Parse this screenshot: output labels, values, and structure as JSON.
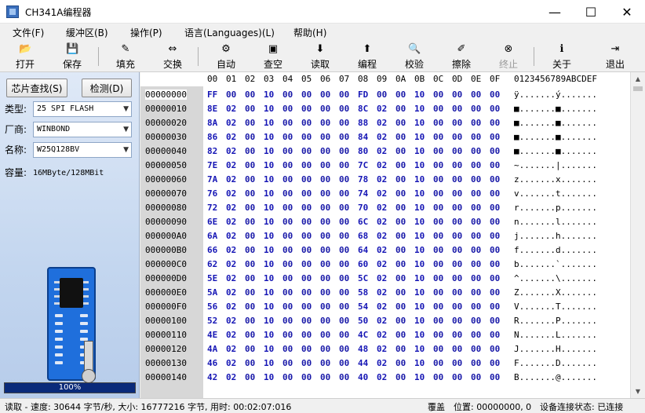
{
  "window": {
    "title": "CH341A编程器",
    "min_glyph": "—",
    "max_glyph": "☐",
    "close_glyph": "✕"
  },
  "menu": [
    "文件(F)",
    "缓冲区(B)",
    "操作(P)",
    "语言(Languages)(L)",
    "帮助(H)"
  ],
  "toolbar": [
    {
      "label": "打开",
      "icon": "open-folder-icon",
      "glyph": "📂",
      "enabled": true
    },
    {
      "label": "保存",
      "icon": "save-disk-icon",
      "glyph": "💾",
      "enabled": true
    },
    {
      "label": "填充",
      "icon": "fill-icon",
      "glyph": "✎",
      "enabled": true
    },
    {
      "label": "交换",
      "icon": "swap-arrows-icon",
      "glyph": "⇔",
      "enabled": true
    },
    {
      "label": "自动",
      "icon": "auto-icon",
      "glyph": "⚙",
      "enabled": true
    },
    {
      "label": "查空",
      "icon": "blank-check-icon",
      "glyph": "▣",
      "enabled": true
    },
    {
      "label": "读取",
      "icon": "read-icon",
      "glyph": "⬇",
      "enabled": true
    },
    {
      "label": "编程",
      "icon": "program-icon",
      "glyph": "⬆",
      "enabled": true
    },
    {
      "label": "校验",
      "icon": "verify-icon",
      "glyph": "🔍",
      "enabled": true
    },
    {
      "label": "擦除",
      "icon": "erase-icon",
      "glyph": "✐",
      "enabled": true
    },
    {
      "label": "终止",
      "icon": "stop-icon",
      "glyph": "⊗",
      "enabled": false
    },
    {
      "label": "关于",
      "icon": "about-info-icon",
      "glyph": "ℹ",
      "enabled": true
    },
    {
      "label": "退出",
      "icon": "exit-icon",
      "glyph": "⇥",
      "enabled": true
    }
  ],
  "left": {
    "find_chip": "芯片查找(S)",
    "detect": "检测(D)",
    "type_label": "类型:",
    "type_value": "25 SPI FLASH",
    "vendor_label": "厂商:",
    "vendor_value": "WINBOND",
    "name_label": "名称:",
    "name_value": "W25Q128BV",
    "capacity_label": "容量:",
    "capacity_value": "16MByte/128MBit",
    "progress_text": "100%",
    "progress": 1.0
  },
  "hex": {
    "header_cols": [
      "00",
      "01",
      "02",
      "03",
      "04",
      "05",
      "06",
      "07",
      "08",
      "09",
      "0A",
      "0B",
      "0C",
      "0D",
      "0E",
      "0F"
    ],
    "ascii_header": "0123456789ABCDEF",
    "rows": [
      {
        "addr": "00000000",
        "bytes": [
          "FF",
          "00",
          "00",
          "10",
          "00",
          "00",
          "00",
          "00",
          "FD",
          "00",
          "00",
          "10",
          "00",
          "00",
          "00",
          "00"
        ],
        "ascii": "ÿ.......ý......."
      },
      {
        "addr": "00000010",
        "bytes": [
          "8E",
          "02",
          "00",
          "10",
          "00",
          "00",
          "00",
          "00",
          "8C",
          "02",
          "00",
          "10",
          "00",
          "00",
          "00",
          "00"
        ],
        "ascii": "■.......■......."
      },
      {
        "addr": "00000020",
        "bytes": [
          "8A",
          "02",
          "00",
          "10",
          "00",
          "00",
          "00",
          "00",
          "88",
          "02",
          "00",
          "10",
          "00",
          "00",
          "00",
          "00"
        ],
        "ascii": "■.......■......."
      },
      {
        "addr": "00000030",
        "bytes": [
          "86",
          "02",
          "00",
          "10",
          "00",
          "00",
          "00",
          "00",
          "84",
          "02",
          "00",
          "10",
          "00",
          "00",
          "00",
          "00"
        ],
        "ascii": "■.......■......."
      },
      {
        "addr": "00000040",
        "bytes": [
          "82",
          "02",
          "00",
          "10",
          "00",
          "00",
          "00",
          "00",
          "80",
          "02",
          "00",
          "10",
          "00",
          "00",
          "00",
          "00"
        ],
        "ascii": "■.......■......."
      },
      {
        "addr": "00000050",
        "bytes": [
          "7E",
          "02",
          "00",
          "10",
          "00",
          "00",
          "00",
          "00",
          "7C",
          "02",
          "00",
          "10",
          "00",
          "00",
          "00",
          "00"
        ],
        "ascii": "~.......|......."
      },
      {
        "addr": "00000060",
        "bytes": [
          "7A",
          "02",
          "00",
          "10",
          "00",
          "00",
          "00",
          "00",
          "78",
          "02",
          "00",
          "10",
          "00",
          "00",
          "00",
          "00"
        ],
        "ascii": "z.......x......."
      },
      {
        "addr": "00000070",
        "bytes": [
          "76",
          "02",
          "00",
          "10",
          "00",
          "00",
          "00",
          "00",
          "74",
          "02",
          "00",
          "10",
          "00",
          "00",
          "00",
          "00"
        ],
        "ascii": "v.......t......."
      },
      {
        "addr": "00000080",
        "bytes": [
          "72",
          "02",
          "00",
          "10",
          "00",
          "00",
          "00",
          "00",
          "70",
          "02",
          "00",
          "10",
          "00",
          "00",
          "00",
          "00"
        ],
        "ascii": "r.......p......."
      },
      {
        "addr": "00000090",
        "bytes": [
          "6E",
          "02",
          "00",
          "10",
          "00",
          "00",
          "00",
          "00",
          "6C",
          "02",
          "00",
          "10",
          "00",
          "00",
          "00",
          "00"
        ],
        "ascii": "n.......l......."
      },
      {
        "addr": "000000A0",
        "bytes": [
          "6A",
          "02",
          "00",
          "10",
          "00",
          "00",
          "00",
          "00",
          "68",
          "02",
          "00",
          "10",
          "00",
          "00",
          "00",
          "00"
        ],
        "ascii": "j.......h......."
      },
      {
        "addr": "000000B0",
        "bytes": [
          "66",
          "02",
          "00",
          "10",
          "00",
          "00",
          "00",
          "00",
          "64",
          "02",
          "00",
          "10",
          "00",
          "00",
          "00",
          "00"
        ],
        "ascii": "f.......d......."
      },
      {
        "addr": "000000C0",
        "bytes": [
          "62",
          "02",
          "00",
          "10",
          "00",
          "00",
          "00",
          "00",
          "60",
          "02",
          "00",
          "10",
          "00",
          "00",
          "00",
          "00"
        ],
        "ascii": "b.......`......."
      },
      {
        "addr": "000000D0",
        "bytes": [
          "5E",
          "02",
          "00",
          "10",
          "00",
          "00",
          "00",
          "00",
          "5C",
          "02",
          "00",
          "10",
          "00",
          "00",
          "00",
          "00"
        ],
        "ascii": "^.......\\......."
      },
      {
        "addr": "000000E0",
        "bytes": [
          "5A",
          "02",
          "00",
          "10",
          "00",
          "00",
          "00",
          "00",
          "58",
          "02",
          "00",
          "10",
          "00",
          "00",
          "00",
          "00"
        ],
        "ascii": "Z.......X......."
      },
      {
        "addr": "000000F0",
        "bytes": [
          "56",
          "02",
          "00",
          "10",
          "00",
          "00",
          "00",
          "00",
          "54",
          "02",
          "00",
          "10",
          "00",
          "00",
          "00",
          "00"
        ],
        "ascii": "V.......T......."
      },
      {
        "addr": "00000100",
        "bytes": [
          "52",
          "02",
          "00",
          "10",
          "00",
          "00",
          "00",
          "00",
          "50",
          "02",
          "00",
          "10",
          "00",
          "00",
          "00",
          "00"
        ],
        "ascii": "R.......P......."
      },
      {
        "addr": "00000110",
        "bytes": [
          "4E",
          "02",
          "00",
          "10",
          "00",
          "00",
          "00",
          "00",
          "4C",
          "02",
          "00",
          "10",
          "00",
          "00",
          "00",
          "00"
        ],
        "ascii": "N.......L......."
      },
      {
        "addr": "00000120",
        "bytes": [
          "4A",
          "02",
          "00",
          "10",
          "00",
          "00",
          "00",
          "00",
          "48",
          "02",
          "00",
          "10",
          "00",
          "00",
          "00",
          "00"
        ],
        "ascii": "J.......H......."
      },
      {
        "addr": "00000130",
        "bytes": [
          "46",
          "02",
          "00",
          "10",
          "00",
          "00",
          "00",
          "00",
          "44",
          "02",
          "00",
          "10",
          "00",
          "00",
          "00",
          "00"
        ],
        "ascii": "F.......D......."
      },
      {
        "addr": "00000140",
        "bytes": [
          "42",
          "02",
          "00",
          "10",
          "00",
          "00",
          "00",
          "00",
          "40",
          "02",
          "00",
          "10",
          "00",
          "00",
          "00",
          "00"
        ],
        "ascii": "B.......@......."
      }
    ]
  },
  "status": {
    "left": "读取 - 速度: 30644 字节/秒, 大小: 16777216 字节, 用时: 00:02:07:016",
    "mode": "覆盖",
    "position": "位置: 00000000, 0",
    "device": "设备连接状态: 已连接"
  },
  "colors": {
    "hex_blue": "#1515b5",
    "panel_blue": "#c3d6ef",
    "board_blue": "#1f6fdc"
  }
}
